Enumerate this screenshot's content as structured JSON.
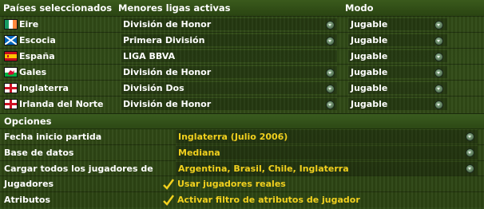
{
  "header": {
    "countries": "Países seleccionados",
    "leagues": "Menores ligas activas",
    "mode": "Modo"
  },
  "countries": [
    {
      "name": "Eire",
      "flag": "ireland-flag-icon",
      "league": "División de Honor",
      "mode": "Jugable"
    },
    {
      "name": "Escocia",
      "flag": "scotland-flag-icon",
      "league": "Primera División",
      "mode": "Jugable"
    },
    {
      "name": "España",
      "flag": "spain-flag-icon",
      "league": "LIGA BBVA",
      "mode": "Jugable"
    },
    {
      "name": "Gales",
      "flag": "wales-flag-icon",
      "league": "División de Honor",
      "mode": "Jugable"
    },
    {
      "name": "Inglaterra",
      "flag": "england-flag-icon",
      "league": "División Dos",
      "mode": "Jugable"
    },
    {
      "name": "Irlanda del Norte",
      "flag": "northern-ireland-flag-icon",
      "league": "División de Honor",
      "mode": "Jugable"
    }
  ],
  "options": {
    "title": "Opciones",
    "start_date_label": "Fecha inicio partida",
    "start_date_value": "Inglaterra (Julio 2006)",
    "database_label": "Base de datos",
    "database_value": "Mediana",
    "load_players_label": "Cargar todos los jugadores de",
    "load_players_value": "Argentina, Brasil, Chile, Inglaterra",
    "players_label": "Jugadores",
    "players_value": "Usar jugadores reales",
    "attributes_label": "Atributos",
    "attributes_value": "Activar filtro de atributos de jugador"
  },
  "colors": {
    "accent_text": "#f1d01e",
    "background": "#2f4a16"
  }
}
